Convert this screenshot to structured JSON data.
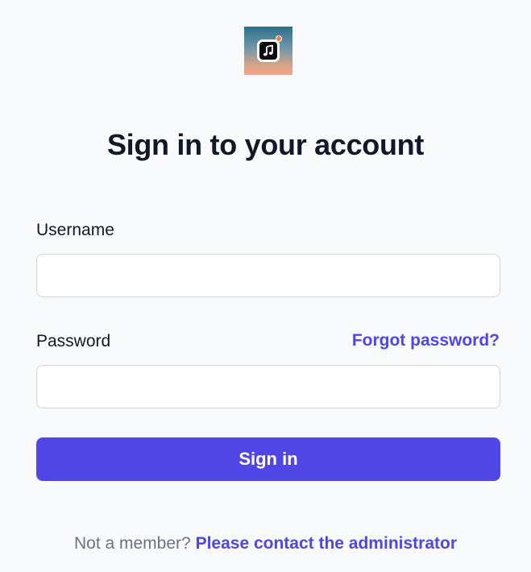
{
  "app": {
    "logo_icon": "music-note-icon"
  },
  "header": {
    "title": "Sign in to your account"
  },
  "form": {
    "username_label": "Username",
    "username_value": "",
    "password_label": "Password",
    "password_value": "",
    "forgot_password_label": "Forgot password?",
    "submit_label": "Sign in"
  },
  "footer": {
    "prompt": "Not a member?",
    "link_label": "Please contact the administrator"
  },
  "colors": {
    "accent": "#4f46e5",
    "button_bg": "#5046e5",
    "background": "#f9fafb",
    "text": "#111827",
    "muted_text": "#6b7280",
    "input_border": "#d1d5db"
  }
}
